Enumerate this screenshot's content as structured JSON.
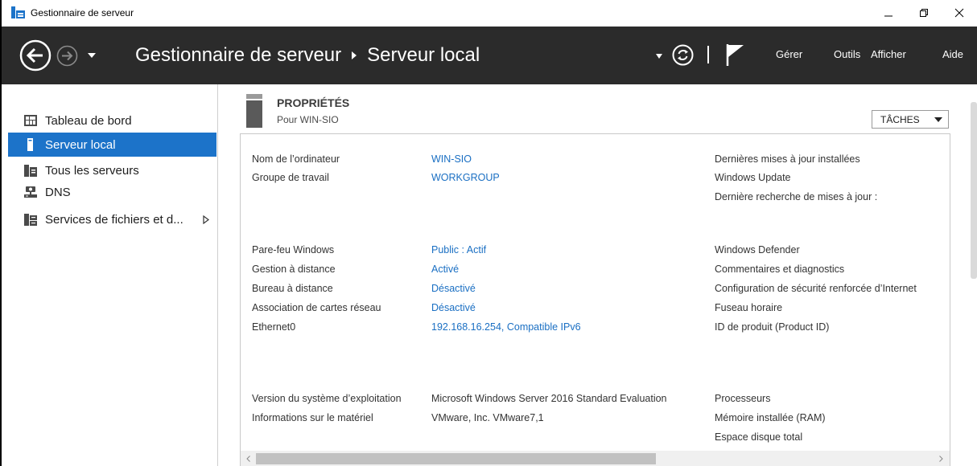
{
  "window": {
    "title": "Gestionnaire de serveur"
  },
  "header": {
    "breadcrumb_root": "Gestionnaire de serveur",
    "breadcrumb_current": "Serveur local",
    "menu": {
      "manage": "Gérer",
      "tools": "Outils",
      "view": "Afficher",
      "help": "Aide"
    }
  },
  "sidebar": {
    "items": [
      {
        "label": "Tableau de bord",
        "icon": "dashboard-icon"
      },
      {
        "label": "Serveur local",
        "icon": "local-server-icon",
        "selected": true
      },
      {
        "label": "Tous les serveurs",
        "icon": "all-servers-icon"
      },
      {
        "label": "DNS",
        "icon": "dns-icon"
      },
      {
        "label": "Services de fichiers et d...",
        "icon": "file-services-icon",
        "expandable": true
      }
    ]
  },
  "section": {
    "title": "PROPRIÉTÉS",
    "subtitle": "Pour WIN-SIO",
    "tasks_label": "TÂCHES"
  },
  "properties": {
    "group1": [
      {
        "label": "Nom de l’ordinateur",
        "value": "WIN-SIO"
      },
      {
        "label": "Groupe de travail",
        "value": "WORKGROUP"
      }
    ],
    "group1_right": [
      "Dernières mises à jour installées",
      "Windows Update",
      "Dernière recherche de mises à jour :"
    ],
    "group2": [
      {
        "label": "Pare-feu Windows",
        "value": "Public : Actif"
      },
      {
        "label": "Gestion à distance",
        "value": "Activé"
      },
      {
        "label": "Bureau à distance",
        "value": "Désactivé"
      },
      {
        "label": "Association de cartes réseau",
        "value": "Désactivé"
      },
      {
        "label": "Ethernet0",
        "value": "192.168.16.254, Compatible IPv6"
      }
    ],
    "group2_right": [
      "Windows Defender",
      "Commentaires et diagnostics",
      "Configuration de sécurité renforcée d’Internet",
      "Fuseau horaire",
      "ID de produit (Product ID)"
    ],
    "group3": [
      {
        "label": "Version du système d’exploitation",
        "value": "Microsoft Windows Server 2016 Standard Evaluation"
      },
      {
        "label": "Informations sur le matériel",
        "value": "VMware, Inc. VMware7,1"
      }
    ],
    "group3_right": [
      "Processeurs",
      "Mémoire installée (RAM)",
      "Espace disque total"
    ]
  },
  "colors": {
    "header_bg": "#2b2b2b",
    "accent": "#1c73c9",
    "link": "#1a6fc3"
  }
}
